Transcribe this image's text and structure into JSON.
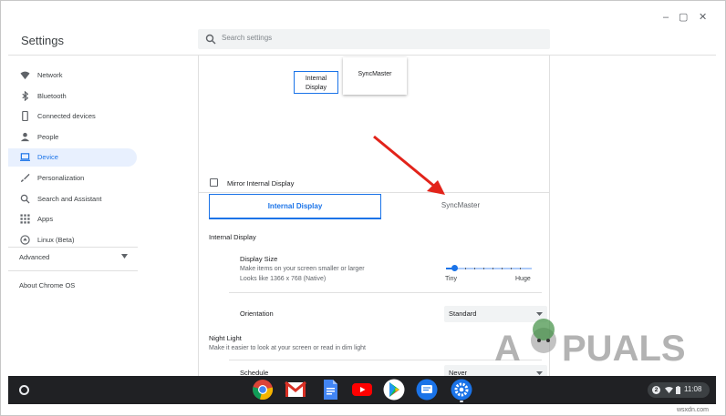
{
  "window": {
    "title": "Settings",
    "controls": {
      "minimize": "–",
      "maximize": "▢",
      "close": "✕"
    }
  },
  "search": {
    "placeholder": "Search settings",
    "icon": "search-icon"
  },
  "sidebar": {
    "items": [
      {
        "label": "Network",
        "icon": "wifi-icon",
        "active": false
      },
      {
        "label": "Bluetooth",
        "icon": "bluetooth-icon",
        "active": false
      },
      {
        "label": "Connected devices",
        "icon": "phone-icon",
        "active": false
      },
      {
        "label": "People",
        "icon": "person-icon",
        "active": false
      },
      {
        "label": "Device",
        "icon": "laptop-icon",
        "active": true
      },
      {
        "label": "Personalization",
        "icon": "brush-icon",
        "active": false
      },
      {
        "label": "Search and Assistant",
        "icon": "search-icon",
        "active": false
      },
      {
        "label": "Apps",
        "icon": "apps-grid-icon",
        "active": false
      },
      {
        "label": "Linux (Beta)",
        "icon": "linux-icon",
        "active": false
      }
    ],
    "advanced_label": "Advanced",
    "about_label": "About Chrome OS"
  },
  "display": {
    "arrangement": {
      "internal_label_line1": "Internal",
      "internal_label_line2": "Display",
      "external_label": "SyncMaster"
    },
    "mirror_label": "Mirror Internal Display",
    "mirror_checked": false,
    "tabs": [
      {
        "label": "Internal Display",
        "selected": true
      },
      {
        "label": "SyncMaster",
        "selected": false
      }
    ],
    "section_title": "Internal Display",
    "size": {
      "title": "Display Size",
      "desc": "Make items on your screen smaller or larger",
      "resolution": "Looks like 1366 x 768 (Native)",
      "slider_min_label": "Tiny",
      "slider_max_label": "Huge",
      "slider_value_fraction": 0.1
    },
    "orientation": {
      "label": "Orientation",
      "value": "Standard"
    },
    "night_light": {
      "title": "Night Light",
      "desc": "Make it easier to look at your screen or read in dim light",
      "schedule_label": "Schedule",
      "schedule_value": "Never"
    }
  },
  "colors": {
    "accent": "#1a73e8",
    "active_nav_bg": "#e8f0fe",
    "arrow": "#e2231a",
    "shelf": "#202124"
  },
  "shelf": {
    "apps": [
      {
        "name": "chrome-icon"
      },
      {
        "name": "gmail-icon"
      },
      {
        "name": "docs-icon"
      },
      {
        "name": "youtube-icon"
      },
      {
        "name": "play-store-icon"
      },
      {
        "name": "messages-icon"
      },
      {
        "name": "settings-icon"
      }
    ],
    "notification_count": "2",
    "time": "11:08"
  },
  "watermark": {
    "text_before": "A",
    "text_after": "PUALS"
  },
  "credit": "wsxdn.com"
}
